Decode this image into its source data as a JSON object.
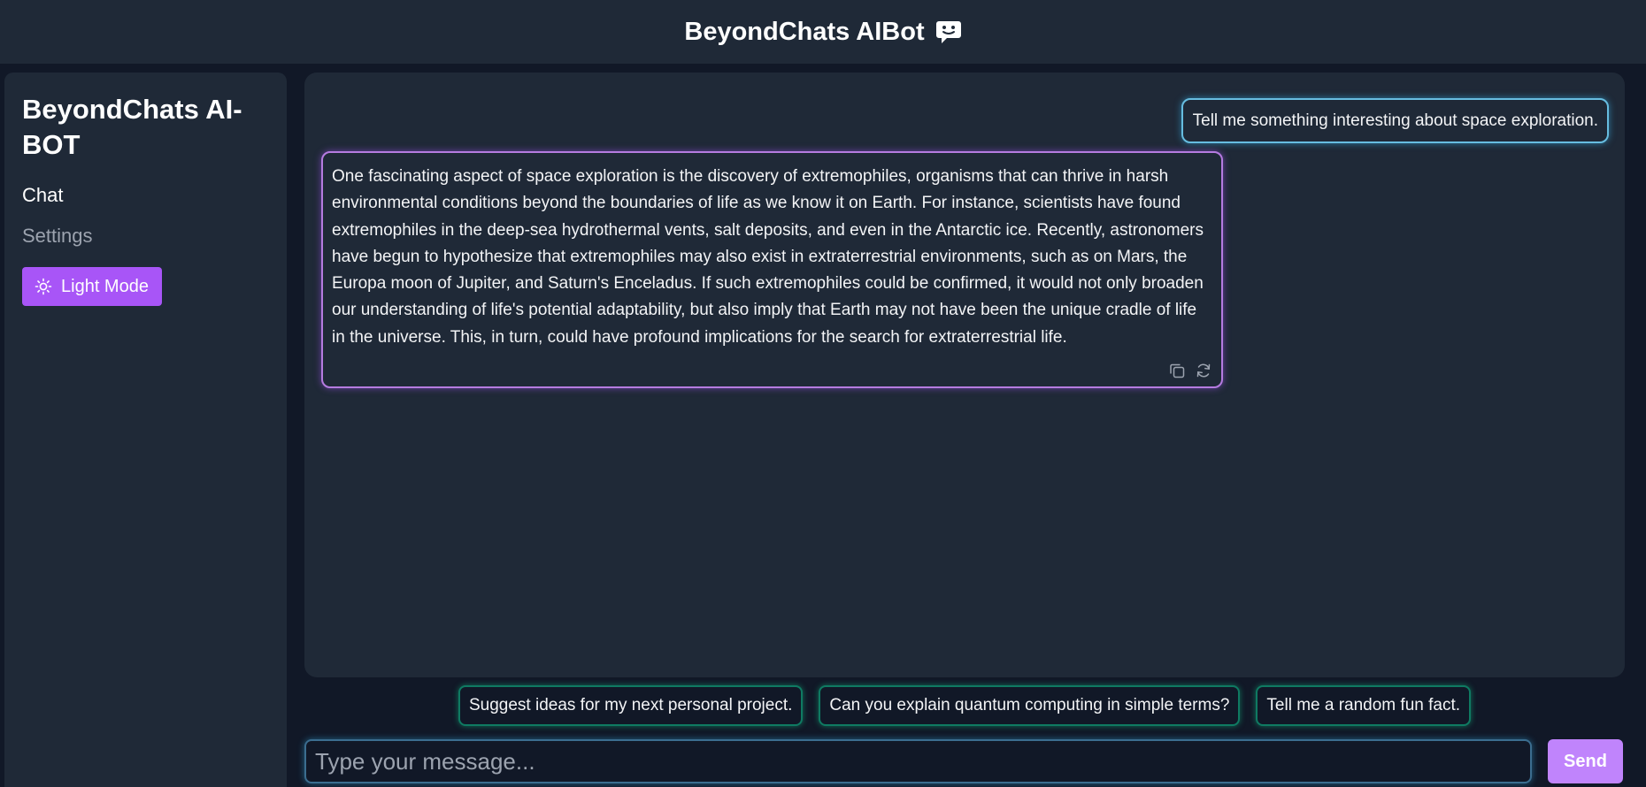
{
  "header": {
    "title": "BeyondChats AIBot",
    "icon": "chat-bot-icon"
  },
  "sidebar": {
    "brand": "BeyondChats AI-BOT",
    "nav": [
      {
        "label": "Chat",
        "active": true
      },
      {
        "label": "Settings",
        "active": false
      }
    ],
    "theme_button": {
      "label": "Light Mode",
      "icon": "sun-icon"
    }
  },
  "chat": {
    "messages": [
      {
        "role": "user",
        "text": "Tell me something interesting about space exploration."
      },
      {
        "role": "bot",
        "text": "One fascinating aspect of space exploration is the discovery of extremophiles, organisms that can thrive in harsh environmental conditions beyond the boundaries of life as we know it on Earth. For instance, scientists have found extremophiles in the deep-sea hydrothermal vents, salt deposits, and even in the Antarctic ice. Recently, astronomers have begun to hypothesize that extremophiles may also exist in extraterrestrial environments, such as on Mars, the Europa moon of Jupiter, and Saturn's Enceladus. If such extremophiles could be confirmed, it would not only broaden our understanding of life's potential adaptability, but also imply that Earth may not have been the unique cradle of life in the universe. This, in turn, could have profound implications for the search for extraterrestrial life."
      }
    ],
    "message_actions": [
      "copy-icon",
      "regenerate-icon"
    ]
  },
  "suggestions": [
    "Suggest ideas for my next personal project.",
    "Can you explain quantum computing in simple terms?",
    "Tell me a random fun fact."
  ],
  "composer": {
    "placeholder": "Type your message...",
    "value": "",
    "send_label": "Send"
  },
  "colors": {
    "accent_purple": "#a855f7",
    "send_purple": "#c084fc",
    "user_border": "#67bde0",
    "bot_border": "#b57be0",
    "chip_border": "#0f7a62",
    "panel": "#1f2937",
    "background": "#111827"
  }
}
